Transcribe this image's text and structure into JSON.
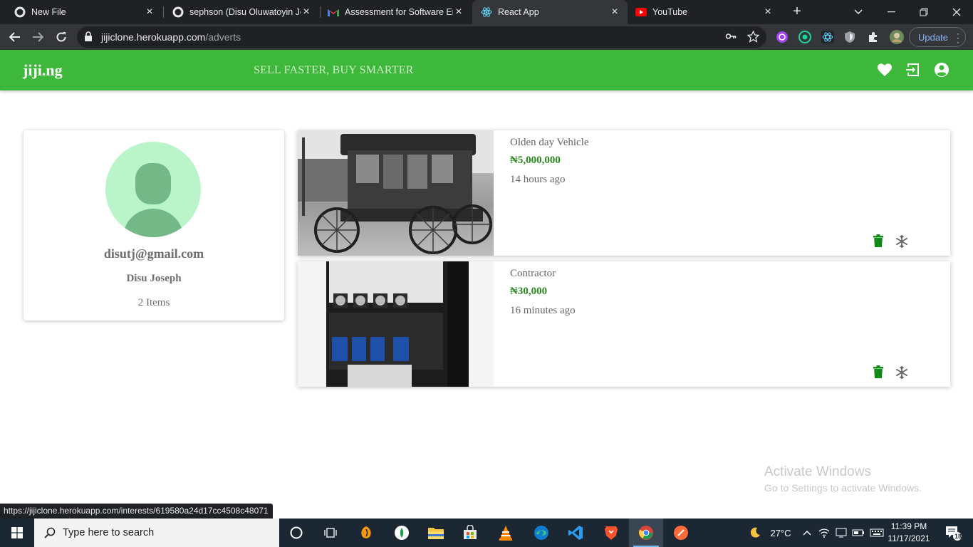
{
  "browser": {
    "tabs": [
      {
        "title": "New File",
        "icon": "github-icon"
      },
      {
        "title": "sephson (Disu Oluwatoyin Jo",
        "icon": "github-icon"
      },
      {
        "title": "Assessment for Software Eng",
        "icon": "gmail-icon"
      },
      {
        "title": "React App",
        "icon": "react-icon",
        "active": true
      },
      {
        "title": "YouTube",
        "icon": "youtube-icon"
      }
    ],
    "url_host": "jijiclone.herokuapp.com",
    "url_path": "/adverts",
    "update_label": "Update",
    "status_url": "https://jijiclone.herokuapp.com/interests/619580a24d17cc4508c48071"
  },
  "site": {
    "logo": "jiji.ng",
    "tagline": "SELL FASTER, BUY SMARTER",
    "brand_color": "#3db83a"
  },
  "profile": {
    "email": "disutj@gmail.com",
    "name": "Disu Joseph",
    "items_count": "2 Items"
  },
  "adverts": [
    {
      "title": "Olden day Vehicle",
      "price": "₦5,000,000",
      "time": "14 hours ago",
      "image": "vintage-car"
    },
    {
      "title": "Contractor",
      "price": "₦30,000",
      "time": "16 minutes ago",
      "image": "electrical-contactor"
    }
  ],
  "watermark": {
    "line1": "Activate Windows",
    "line2": "Go to Settings to activate Windows."
  },
  "taskbar": {
    "search_placeholder": "Type here to search",
    "weather": "27°C",
    "time": "11:39 PM",
    "date": "11/17/2021",
    "notifications": "18"
  }
}
